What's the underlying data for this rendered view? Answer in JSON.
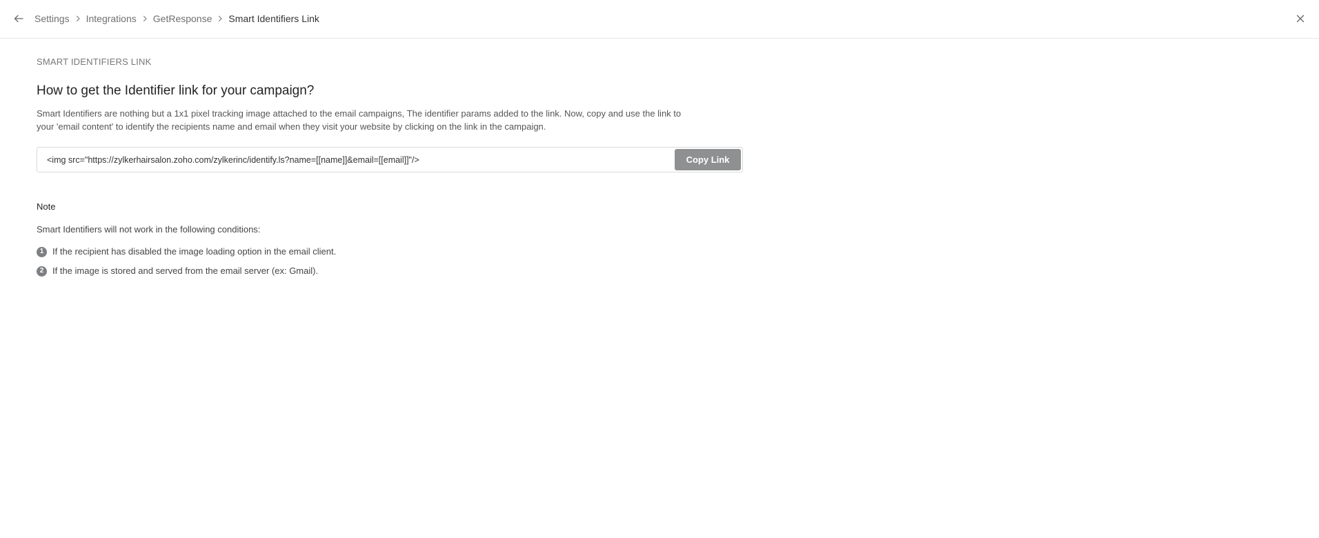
{
  "breadcrumb": {
    "items": [
      "Settings",
      "Integrations",
      "GetResponse"
    ],
    "current": "Smart Identifiers Link"
  },
  "page": {
    "section_label": "SMART IDENTIFIERS LINK",
    "title": "How to get the Identifier link for your campaign?",
    "description": "Smart Identifiers are nothing but a 1x1 pixel tracking image attached to the email campaigns, The identifier params added to the link. Now, copy and use the link to your 'email content' to identify the recipients name and email when they visit your website by clicking on the link in the campaign."
  },
  "link_box": {
    "code": "<img src=\"https://zylkerhairsalon.zoho.com/zylkerinc/identify.ls?name=[[name]]&email=[[email]]\"/>",
    "copy_label": "Copy Link"
  },
  "note": {
    "title": "Note",
    "intro": "Smart Identifiers will not work in the following conditions:",
    "items": [
      {
        "num": "1",
        "text": "If the recipient has disabled the image loading option in the email client."
      },
      {
        "num": "2",
        "text": "If the image is stored and served from the email server (ex: Gmail)."
      }
    ]
  },
  "icons": {
    "back": "arrow-left-icon",
    "separator": "chevron-right-icon",
    "close": "close-icon"
  },
  "colors": {
    "button_bg": "#8e9092",
    "badge_bg": "#7d7f82",
    "breadcrumb_link": "#6f6f6f"
  }
}
